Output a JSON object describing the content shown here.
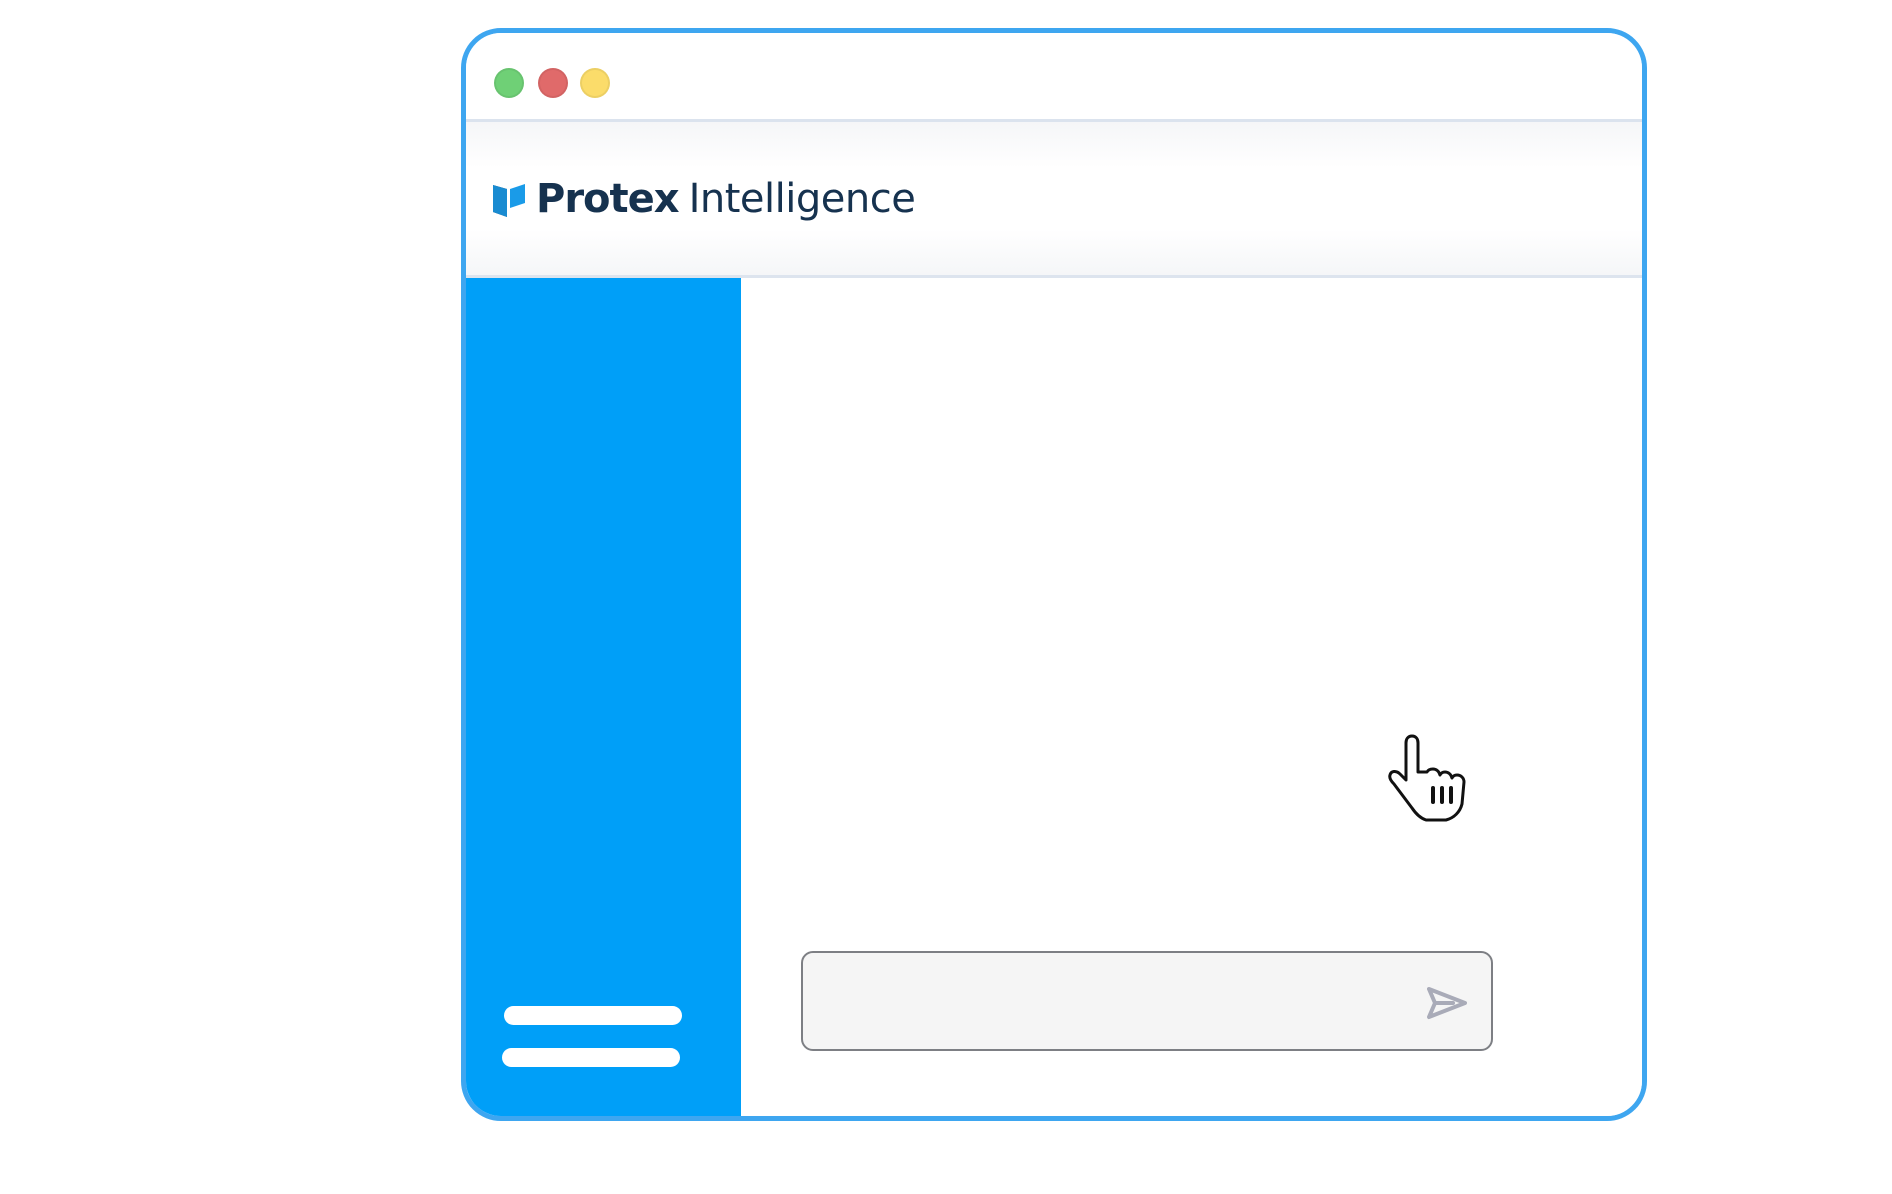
{
  "window": {
    "controls": [
      "close",
      "minimize",
      "maximize"
    ]
  },
  "header": {
    "brand_name": "Protex",
    "brand_suffix": "Intelligence",
    "brand_icon": "book-flag-icon"
  },
  "sidebar": {
    "items": [
      {
        "icon": "menu-line"
      },
      {
        "icon": "menu-line"
      }
    ]
  },
  "chat": {
    "input_value": "",
    "input_placeholder": "",
    "send_icon": "send-arrow-icon"
  },
  "pointer": {
    "icon": "hand-pointer-icon"
  },
  "colors": {
    "accent": "#009ff8",
    "window_border": "#3ea6f0",
    "brand_text": "#16324f",
    "dot_green": "#6fd076",
    "dot_red": "#e06a6a",
    "dot_yellow": "#fbdc6a",
    "send_icon": "#a9abb8"
  }
}
